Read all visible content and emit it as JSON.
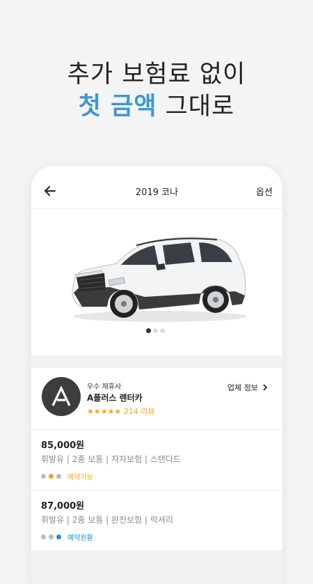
{
  "headline": {
    "line1": "추가 보험료 없이",
    "line2_accent": "첫 금액",
    "line2_rest": " 그대로"
  },
  "appbar": {
    "title": "2019 코나",
    "option_label": "옵션"
  },
  "carousel": {
    "page_count": 3,
    "active_index": 0
  },
  "vendor": {
    "tagline": "우수 제휴사",
    "name": "A플러스 렌터카",
    "stars": "★★★★★",
    "reviews": "214 리뷰",
    "info_label": "업체 정보"
  },
  "plans": [
    {
      "price": "85,000원",
      "desc": "휘발유 | 2종 보통 | 자차보험 | 스탠다드",
      "status": "예약가능",
      "status_color": "#f5a41b"
    },
    {
      "price": "87,000원",
      "desc": "휘발유 | 2종 보통 | 완전보험 | 럭셔리",
      "status": "예약원활",
      "status_color": "#1a8fe3"
    }
  ],
  "colors": {
    "accent": "#3a97d4",
    "star": "#f5a41b",
    "available": "#f5a41b",
    "smooth": "#1a8fe3"
  }
}
